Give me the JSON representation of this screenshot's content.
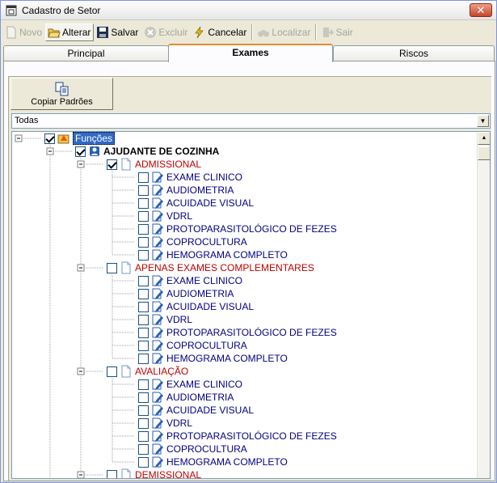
{
  "window": {
    "title": "Cadastro de Setor",
    "close_glyph": "✕"
  },
  "toolbar": {
    "novo": "Novo",
    "alterar": "Alterar",
    "salvar": "Salvar",
    "excluir": "Excluir",
    "cancelar": "Cancelar",
    "localizar": "Localizar",
    "sair": "Sair"
  },
  "tabs": {
    "principal": "Principal",
    "exames": "Exames",
    "riscos": "Riscos"
  },
  "copy_button": "Copiar Padrões",
  "filter": {
    "value": "Todas"
  },
  "tree": {
    "root": "Funções",
    "job": "AJUDANTE DE COZINHA",
    "groups": [
      {
        "label": "ADMISSIONAL",
        "checked": true,
        "exams": [
          "EXAME CLINICO",
          "AUDIOMETRIA",
          "ACUIDADE VISUAL",
          "VDRL",
          "PROTOPARASITOLÓGICO DE FEZES",
          "COPROCULTURA",
          "HEMOGRAMA COMPLETO"
        ]
      },
      {
        "label": "APENAS EXAMES COMPLEMENTARES",
        "checked": false,
        "exams": [
          "EXAME CLINICO",
          "AUDIOMETRIA",
          "ACUIDADE VISUAL",
          "VDRL",
          "PROTOPARASITOLÓGICO DE FEZES",
          "COPROCULTURA",
          "HEMOGRAMA COMPLETO"
        ]
      },
      {
        "label": "AVALIAÇÃO",
        "checked": false,
        "exams": [
          "EXAME CLINICO",
          "AUDIOMETRIA",
          "ACUIDADE VISUAL",
          "VDRL",
          "PROTOPARASITOLÓGICO DE FEZES",
          "COPROCULTURA",
          "HEMOGRAMA COMPLETO"
        ]
      },
      {
        "label": "DEMISSIONAL",
        "checked": false,
        "exams": []
      }
    ]
  },
  "colors": {
    "type_label": "#c00000",
    "exam_label": "#000080",
    "selection": "#316ac5",
    "tab_highlight": "#e68b2c"
  }
}
